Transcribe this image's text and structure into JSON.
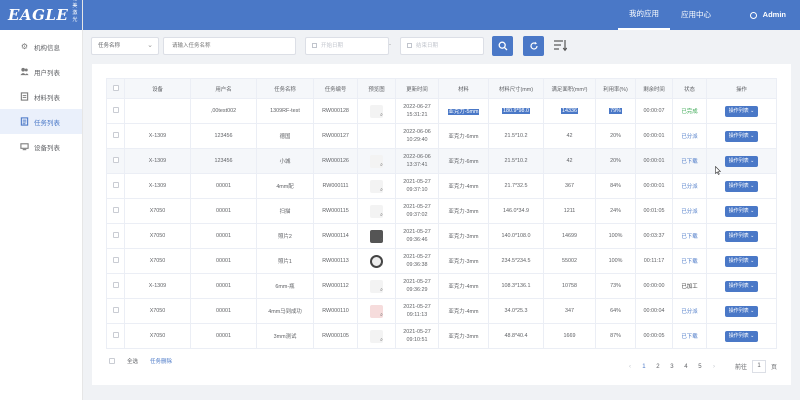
{
  "brand": {
    "logo_text": "EAGLE",
    "logo_sub": "格美激光"
  },
  "sidebar": {
    "items": [
      {
        "label": "机构信息",
        "icon": "gear-icon"
      },
      {
        "label": "用户列表",
        "icon": "users-icon"
      },
      {
        "label": "材料列表",
        "icon": "box-icon"
      },
      {
        "label": "任务列表",
        "icon": "task-icon"
      },
      {
        "label": "设备列表",
        "icon": "device-icon"
      }
    ]
  },
  "header": {
    "nav": [
      {
        "label": "我的应用"
      },
      {
        "label": "应用中心"
      }
    ],
    "user": "Admin"
  },
  "filter": {
    "field_select": "任务名称",
    "search_placeholder": "请输入任务名称",
    "start_placeholder": "开始日期",
    "end_placeholder": "结束日期",
    "separator": "-"
  },
  "table": {
    "columns": [
      "",
      "设备",
      "用户名",
      "任务名称",
      "任务编号",
      "预览图",
      "更新时间",
      "材料",
      "材料尺寸(mm)",
      "满足面积(mm²)",
      "利用率(%)",
      "剩余时间",
      "状态",
      "操作"
    ],
    "rows": [
      {
        "device": "",
        "user": ",00test002",
        "task": "1309RF-test",
        "no": "RW000128",
        "thumb": "light",
        "time1": "2022-06-27",
        "time2": "15:31:21",
        "material": "亚克力-5mm",
        "size": "180.9*98.0",
        "area": "14336",
        "rate": "79%",
        "remain": "00:00:07",
        "status": "已完成",
        "status_class": "st-green",
        "op": "操作列表",
        "highlight": true
      },
      {
        "device": "X-1309",
        "user": "123456",
        "task": "德国",
        "no": "RW000127",
        "thumb": "blank",
        "time1": "2022-06-06",
        "time2": "10:29:40",
        "material": "亚克力-6mm",
        "size": "21.5*10.2",
        "area": "42",
        "rate": "20%",
        "remain": "00:00:01",
        "status": "已分派",
        "status_class": "st-blue",
        "op": "操作列表"
      },
      {
        "device": "X-1309",
        "user": "123456",
        "task": "小城",
        "no": "RW000126",
        "thumb": "light",
        "time1": "2022-06-06",
        "time2": "13:37:41",
        "material": "亚克力-6mm",
        "size": "21.5*10.2",
        "area": "42",
        "rate": "20%",
        "remain": "00:00:01",
        "status": "已下载",
        "status_class": "st-blue",
        "op": "操作列表",
        "hover": true
      },
      {
        "device": "X-1309",
        "user": "00001",
        "task": "4mm配",
        "no": "RW000111",
        "thumb": "light",
        "time1": "2021-05-27",
        "time2": "09:37:10",
        "material": "亚克力-4mm",
        "size": "21.7*32.5",
        "area": "367",
        "rate": "84%",
        "remain": "00:00:01",
        "status": "已分派",
        "status_class": "st-blue",
        "op": "操作列表"
      },
      {
        "device": "X7050",
        "user": "00001",
        "task": "扫描",
        "no": "RW000115",
        "thumb": "light",
        "time1": "2021-05-27",
        "time2": "09:37:02",
        "material": "亚克力-3mm",
        "size": "146.0*34.9",
        "area": "1211",
        "rate": "24%",
        "remain": "00:01:05",
        "status": "已分派",
        "status_class": "st-blue",
        "op": "操作列表"
      },
      {
        "device": "X7050",
        "user": "00001",
        "task": "照片2",
        "no": "RW000114",
        "thumb": "dog",
        "time1": "2021-05-27",
        "time2": "09:36:46",
        "material": "亚克力-3mm",
        "size": "140.0*108.0",
        "area": "14699",
        "rate": "100%",
        "remain": "00:03:37",
        "status": "已下载",
        "status_class": "st-blue",
        "op": "操作列表"
      },
      {
        "device": "X7050",
        "user": "00001",
        "task": "照片1",
        "no": "RW000113",
        "thumb": "round",
        "time1": "2021-05-27",
        "time2": "09:36:38",
        "material": "亚克力-3mm",
        "size": "234.5*234.5",
        "area": "55002",
        "rate": "100%",
        "remain": "00:11:17",
        "status": "已下载",
        "status_class": "st-blue",
        "op": "操作列表"
      },
      {
        "device": "X-1309",
        "user": "00001",
        "task": "6mm-瓶",
        "no": "RW000112",
        "thumb": "light",
        "time1": "2021-05-27",
        "time2": "09:36:29",
        "material": "亚克力-4mm",
        "size": "108.3*136.1",
        "area": "10758",
        "rate": "73%",
        "remain": "00:00:00",
        "status": "已加工",
        "status_class": "st-dark",
        "op": "操作列表"
      },
      {
        "device": "X7050",
        "user": "00001",
        "task": "4mm马到成功",
        "no": "RW000110",
        "thumb": "pink",
        "time1": "2021-05-27",
        "time2": "09:11:13",
        "material": "亚克力-4mm",
        "size": "34.0*25.3",
        "area": "347",
        "rate": "64%",
        "remain": "00:00:04",
        "status": "已分派",
        "status_class": "st-blue",
        "op": "操作列表"
      },
      {
        "device": "X7050",
        "user": "00001",
        "task": "3mm测试",
        "no": "RW000105",
        "thumb": "light",
        "time1": "2021-05-27",
        "time2": "09:10:51",
        "material": "亚克力-3mm",
        "size": "48.8*40.4",
        "area": "1669",
        "rate": "87%",
        "remain": "00:00:05",
        "status": "已下载",
        "status_class": "st-blue",
        "op": "操作列表"
      }
    ]
  },
  "footer": {
    "select_all": "全选",
    "delete": "任务删除"
  },
  "pager": {
    "pages": [
      "1",
      "2",
      "3",
      "4",
      "5"
    ],
    "current": "1",
    "goto_label": "前往",
    "goto_value": "1",
    "page_unit": "页",
    "prev": "‹",
    "next": "›"
  },
  "colors": {
    "primary": "#4a78c7",
    "success": "#3aa853"
  }
}
